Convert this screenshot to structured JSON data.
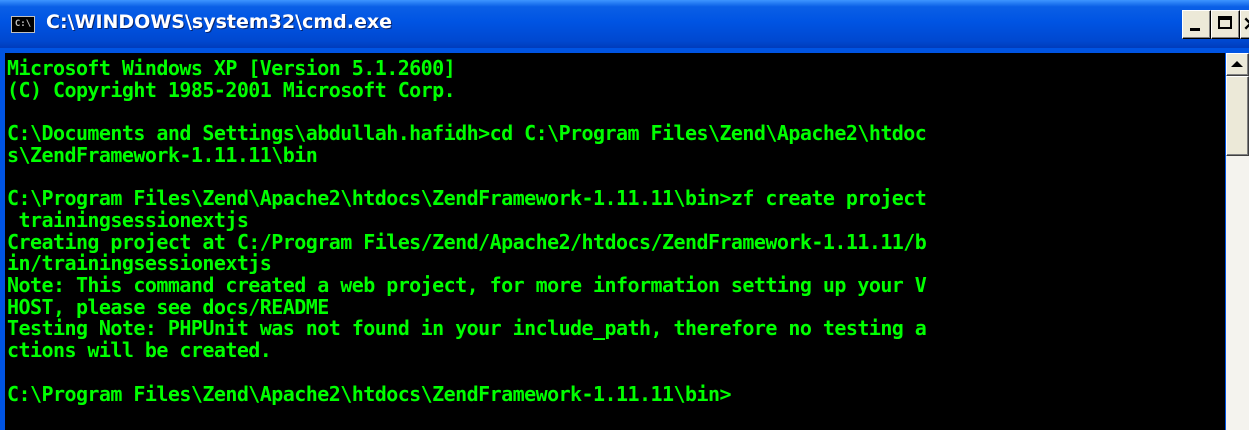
{
  "window": {
    "icon_text": "C:\\",
    "title": "C:\\WINDOWS\\system32\\cmd.exe",
    "controls": {
      "minimize": "minimize",
      "maximize": "maximize",
      "close": "×"
    }
  },
  "console": {
    "foreground_color": "#00ff00",
    "background_color": "#000000",
    "lines": [
      "Microsoft Windows XP [Version 5.1.2600]",
      "(C) Copyright 1985-2001 Microsoft Corp.",
      "",
      "C:\\Documents and Settings\\abdullah.hafidh>cd C:\\Program Files\\Zend\\Apache2\\htdoc",
      "s\\ZendFramework-1.11.11\\bin",
      "",
      "C:\\Program Files\\Zend\\Apache2\\htdocs\\ZendFramework-1.11.11\\bin>zf create project",
      " trainingsessionextjs",
      "Creating project at C:/Program Files/Zend/Apache2/htdocs/ZendFramework-1.11.11/b",
      "in/trainingsessionextjs",
      "Note: This command created a web project, for more information setting up your V",
      "HOST, please see docs/README",
      "Testing Note: PHPUnit was not found in your include_path, therefore no testing a",
      "ctions will be created.",
      "",
      "C:\\Program Files\\Zend\\Apache2\\htdocs\\ZendFramework-1.11.11\\bin>"
    ]
  },
  "scrollbar": {
    "up_icon": "arrow-up-icon"
  }
}
